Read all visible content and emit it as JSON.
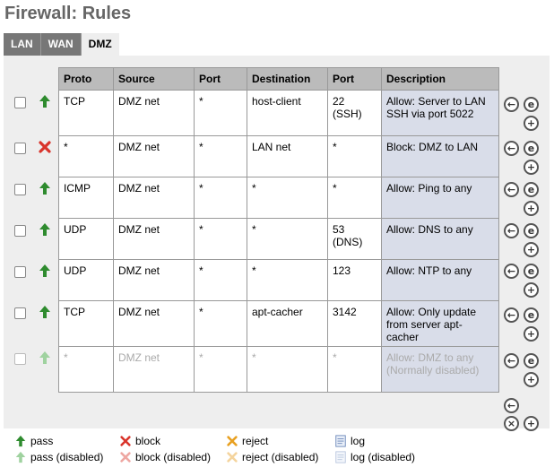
{
  "page_title": "Firewall: Rules",
  "tabs": [
    {
      "label": "LAN",
      "active": false
    },
    {
      "label": "WAN",
      "active": false
    },
    {
      "label": "DMZ",
      "active": true
    }
  ],
  "table": {
    "headers": [
      "Proto",
      "Source",
      "Port",
      "Destination",
      "Port",
      "Description"
    ],
    "rows": [
      {
        "status": "pass",
        "disabled": false,
        "proto": "TCP",
        "source": "DMZ net",
        "sport": "*",
        "dest": "host-client",
        "dport": "22 (SSH)",
        "desc": "Allow: Server to LAN SSH via port 5022"
      },
      {
        "status": "block",
        "disabled": false,
        "proto": "*",
        "source": "DMZ net",
        "sport": "*",
        "dest": "LAN net",
        "dport": "*",
        "desc": "Block: DMZ to LAN"
      },
      {
        "status": "pass",
        "disabled": false,
        "proto": "ICMP",
        "source": "DMZ net",
        "sport": "*",
        "dest": "*",
        "dport": "*",
        "desc": "Allow: Ping to any"
      },
      {
        "status": "pass",
        "disabled": false,
        "proto": "UDP",
        "source": "DMZ net",
        "sport": "*",
        "dest": "*",
        "dport": "53 (DNS)",
        "desc": "Allow: DNS to any"
      },
      {
        "status": "pass",
        "disabled": false,
        "proto": "UDP",
        "source": "DMZ net",
        "sport": "*",
        "dest": "*",
        "dport": "123",
        "desc": "Allow: NTP to any"
      },
      {
        "status": "pass",
        "disabled": false,
        "proto": "TCP",
        "source": "DMZ net",
        "sport": "*",
        "dest": "apt-cacher",
        "dport": "3142",
        "desc": "Allow: Only update from server apt-cacher"
      },
      {
        "status": "pass",
        "disabled": true,
        "proto": "*",
        "source": "DMZ net",
        "sport": "*",
        "dest": "*",
        "dport": "*",
        "desc": "Allow: DMZ to any (Normally disabled)"
      }
    ]
  },
  "legend": {
    "pass": "pass",
    "pass_disabled": "pass (disabled)",
    "block": "block",
    "block_disabled": "block (disabled)",
    "reject": "reject",
    "reject_disabled": "reject (disabled)",
    "log": "log",
    "log_disabled": "log (disabled)"
  },
  "colors": {
    "pass": "#2e8b2e",
    "block": "#d9342b",
    "reject": "#e8a020",
    "header_bg": "#bbbbbb",
    "desc_bg": "#d9dde9",
    "panel_bg": "#eeeeee"
  },
  "icons": {
    "move_up": "left-arrow-circle-icon",
    "edit": "edit-e-circle-icon",
    "add": "plus-circle-icon",
    "delete": "x-circle-icon"
  }
}
